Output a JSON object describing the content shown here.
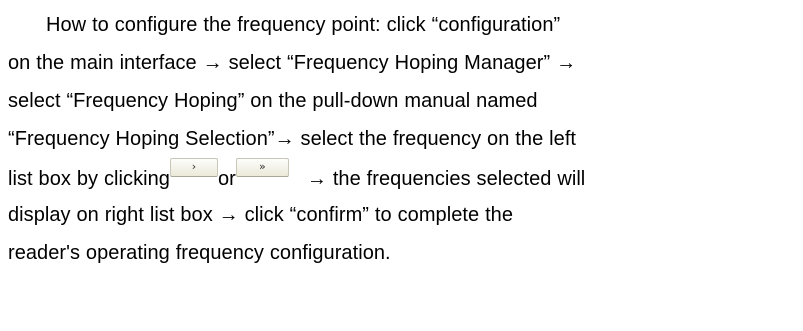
{
  "paragraph": {
    "line1": "How to configure the frequency point: click “configuration”",
    "line2": "on the main interface → select “Frequency Hoping Manager” →",
    "line3": "select “Frequency Hoping” on the pull-down manual named",
    "line4": "“Frequency Hoping Selection”→ select the frequency on the left",
    "line5_a": "list box by clicking",
    "line5_b": "or",
    "line5_c": "→ the frequencies selected will",
    "line6": "display on right list box → click “confirm” to complete the",
    "line7": "reader's operating frequency configuration."
  },
  "buttons": {
    "single_arrow_glyph": "›",
    "double_arrow_glyph": "»"
  },
  "colors": {
    "text": "#000000",
    "background": "#ffffff",
    "button_face": "#ece9d8"
  }
}
